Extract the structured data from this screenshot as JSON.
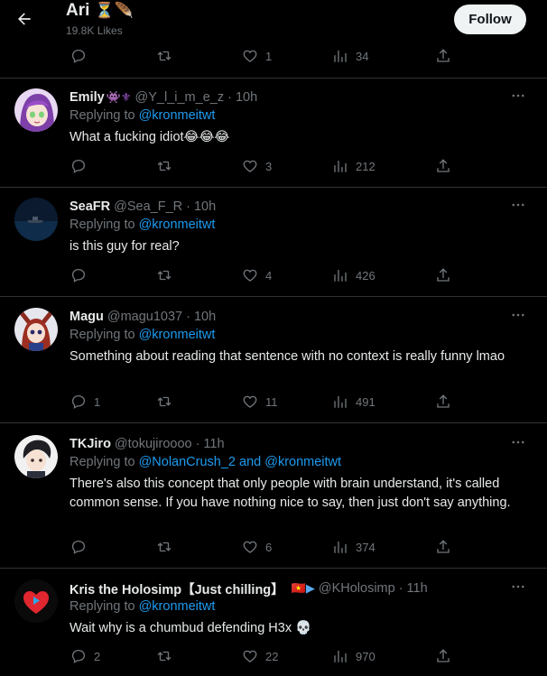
{
  "header": {
    "name": "Ari",
    "emoji": "⏳🪶",
    "likes": "19.8K Likes",
    "follow_label": "Follow"
  },
  "top_actions": {
    "replies": "",
    "retweets": "",
    "likes": "1",
    "views": "34"
  },
  "tweets": [
    {
      "name": "Emily",
      "name_emoji": "👾⚜",
      "handle": "@Y_l_i_m_e_z",
      "time": "10h",
      "replying_prefix": "Replying to ",
      "replying_to": "@kronmeitwt",
      "replying_to_2": "",
      "text": "What a fucking idiot😂😂😂",
      "replies": "",
      "retweets": "",
      "likes": "3",
      "views": "212"
    },
    {
      "name": "SeaFR",
      "name_emoji": "",
      "handle": "@Sea_F_R",
      "time": "10h",
      "replying_prefix": "Replying to ",
      "replying_to": "@kronmeitwt",
      "replying_to_2": "",
      "text": "is this guy for real?",
      "replies": "",
      "retweets": "",
      "likes": "4",
      "views": "426"
    },
    {
      "name": "Magu",
      "name_emoji": "",
      "handle": "@magu1037",
      "time": "10h",
      "replying_prefix": "Replying to ",
      "replying_to": "@kronmeitwt",
      "replying_to_2": "",
      "text": "Something about reading that sentence with no context is really funny lmao",
      "replies": "1",
      "retweets": "",
      "likes": "11",
      "views": "491"
    },
    {
      "name": "TKJiro",
      "name_emoji": "",
      "handle": "@tokujiroooo",
      "time": "11h",
      "replying_prefix": "Replying to ",
      "replying_to": "@NolanCrush_2 and @kronmeitwt",
      "replying_to_2": "",
      "text": "There's also this concept that only people with brain understand, it's called common sense. If you have nothing nice to say, then just don't say anything.",
      "replies": "",
      "retweets": "",
      "likes": "6",
      "views": "374"
    },
    {
      "name": "Kris the Holosimp【Just chilling】",
      "name_emoji": "🇻🇳▶",
      "handle": "@KHolosimp",
      "time": "11h",
      "replying_prefix": "Replying to ",
      "replying_to": "@kronmeitwt",
      "replying_to_2": "",
      "text": "Wait why is a chumbud defending H3x 💀",
      "replies": "2",
      "retweets": "",
      "likes": "22",
      "views": "970"
    }
  ],
  "colors": {
    "background": "#000000",
    "text": "#e7e9ea",
    "secondary": "#71767b",
    "accent": "#1d9bf0",
    "divider": "#2f3336"
  },
  "icons": {
    "back": "arrow-left-icon",
    "reply": "reply-icon",
    "retweet": "retweet-icon",
    "like": "heart-icon",
    "views": "views-icon",
    "share": "share-icon",
    "more": "more-icon"
  }
}
